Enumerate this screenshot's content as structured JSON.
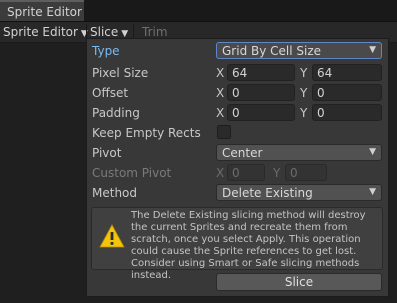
{
  "tab": {
    "label": "Sprite Editor"
  },
  "toolbar": {
    "sprite_editor_menu": "Sprite Editor",
    "slice_menu": "Slice",
    "trim_label": "Trim"
  },
  "slice_panel": {
    "type": {
      "label": "Type",
      "value": "Grid By Cell Size"
    },
    "pixel_size": {
      "label": "Pixel Size",
      "x_label": "X",
      "x": "64",
      "y_label": "Y",
      "y": "64"
    },
    "offset": {
      "label": "Offset",
      "x_label": "X",
      "x": "0",
      "y_label": "Y",
      "y": "0"
    },
    "padding": {
      "label": "Padding",
      "x_label": "X",
      "x": "0",
      "y_label": "Y",
      "y": "0"
    },
    "keep_empty_rects": {
      "label": "Keep Empty Rects",
      "checked": false
    },
    "pivot": {
      "label": "Pivot",
      "value": "Center"
    },
    "custom_pivot": {
      "label": "Custom Pivot",
      "x_label": "X",
      "x": "0",
      "y_label": "Y",
      "y": "0"
    },
    "method": {
      "label": "Method",
      "value": "Delete Existing"
    },
    "warning": "The Delete Existing slicing method will destroy the current Sprites and recreate them from scratch, once you select Apply. This operation could cause the Sprite references to get lost. Consider using Smart or Safe slicing methods instead.",
    "slice_button": "Slice"
  },
  "colors": {
    "accent": "#7bb8f0",
    "warning": "#f2c40c"
  }
}
